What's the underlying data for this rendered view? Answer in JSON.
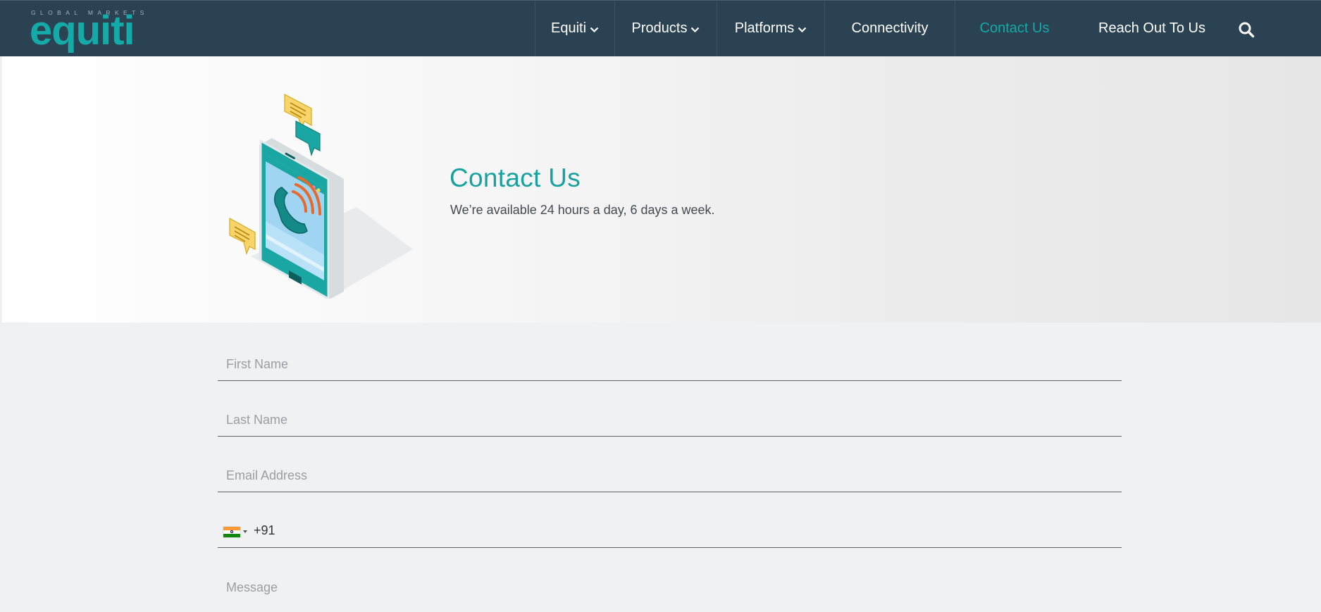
{
  "brand": {
    "tagline": "GLOBAL MARKETS",
    "name": "equiti",
    "accent_color": "#13aaa7",
    "header_bg": "#2b4252"
  },
  "nav": {
    "items": [
      {
        "label": "Equiti",
        "has_dropdown": true
      },
      {
        "label": "Products",
        "has_dropdown": true
      },
      {
        "label": "Platforms",
        "has_dropdown": true
      },
      {
        "label": "Connectivity",
        "has_dropdown": false
      },
      {
        "label": "Contact Us",
        "has_dropdown": false,
        "active": true
      },
      {
        "label": "Reach Out To Us",
        "has_dropdown": false
      }
    ],
    "search_icon": "search-icon"
  },
  "hero": {
    "title": "Contact Us",
    "subtitle": "We’re available 24 hours a day, 6 days a week.",
    "illustration": "phone-call-illustration"
  },
  "form": {
    "first_name": {
      "placeholder": "First Name",
      "value": ""
    },
    "last_name": {
      "placeholder": "Last Name",
      "value": ""
    },
    "email": {
      "placeholder": "Email Address",
      "value": ""
    },
    "phone": {
      "country_flag": "india-flag",
      "dial_code": "+91",
      "value": ""
    },
    "message": {
      "placeholder": "Message",
      "value": ""
    }
  }
}
